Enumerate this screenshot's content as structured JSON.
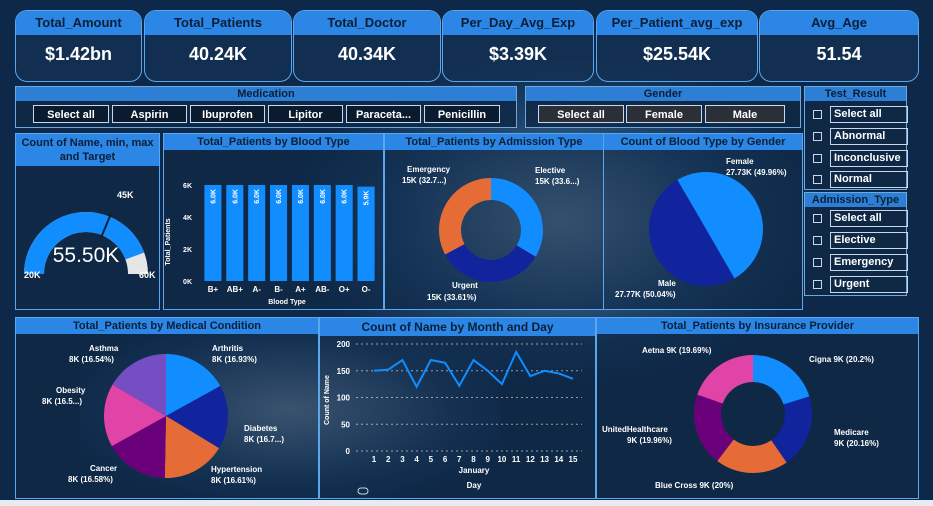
{
  "kpis": [
    {
      "label": "Total_Amount",
      "value": "$1.42bn"
    },
    {
      "label": "Total_Patients",
      "value": "40.24K"
    },
    {
      "label": "Total_Doctor",
      "value": "40.34K"
    },
    {
      "label": "Per_Day_Avg_Exp",
      "value": "$3.39K"
    },
    {
      "label": "Per_Patient_avg_exp",
      "value": "$25.54K"
    },
    {
      "label": "Avg_Age",
      "value": "51.54"
    }
  ],
  "slicers": {
    "medication": {
      "title": "Medication",
      "options": [
        "Select all",
        "Aspirin",
        "Ibuprofen",
        "Lipitor",
        "Paraceta...",
        "Penicillin"
      ]
    },
    "gender": {
      "title": "Gender",
      "options": [
        "Select all",
        "Female",
        "Male"
      ]
    },
    "test_result": {
      "title": "Test_Result",
      "options": [
        "Select all",
        "Abnormal",
        "Inconclusive",
        "Normal"
      ]
    },
    "admission_type": {
      "title": "Admission_Type",
      "options": [
        "Select all",
        "Elective",
        "Emergency",
        "Urgent"
      ]
    }
  },
  "colors": {
    "blue": "#118dff",
    "navy": "#12239e",
    "orange": "#e66c37",
    "purple": "#6b007b",
    "pink": "#e044a7",
    "violet": "#744ec2",
    "gray": "#e6e6e6"
  },
  "chart_data": [
    {
      "type": "gauge",
      "title": "Count of Name, min, max and Target",
      "value_label": "55.50K",
      "value": 55.5,
      "min": 20,
      "max": 60,
      "target": 45,
      "min_label": "20K",
      "max_label": "60K",
      "target_label": "45K"
    },
    {
      "type": "bar",
      "title": "Total_Patients by Blood Type",
      "categories": [
        "B+",
        "AB+",
        "A-",
        "B-",
        "A+",
        "AB-",
        "O+",
        "O-"
      ],
      "values": [
        6.0,
        6.0,
        6.0,
        6.0,
        6.0,
        6.0,
        6.0,
        5.9
      ],
      "data_labels": [
        "6.0K",
        "6.0K",
        "6.0K",
        "6.0K",
        "6.0K",
        "6.0K",
        "6.0K",
        "5.9K"
      ],
      "yticks": [
        "0K",
        "2K",
        "4K",
        "6K"
      ],
      "ylim": [
        0,
        6.5
      ],
      "xlabel": "Blood Type",
      "ylabel": "Total_Patients"
    },
    {
      "type": "donut",
      "title": "Total_Patients by Admission Type",
      "slices": [
        {
          "name": "Elective",
          "value": 33.6,
          "label": "Elective",
          "sublabel": "15K (33.6...)",
          "color": "#118dff"
        },
        {
          "name": "Urgent",
          "value": 33.61,
          "label": "Urgent",
          "sublabel": "15K (33.61%)",
          "color": "#12239e"
        },
        {
          "name": "Emergency",
          "value": 32.79,
          "label": "Emergency",
          "sublabel": "15K (32.7...)",
          "color": "#e66c37"
        }
      ]
    },
    {
      "type": "pie",
      "title": "Count of Blood Type by Gender",
      "slices": [
        {
          "name": "Female",
          "value": 49.96,
          "label": "Female",
          "sublabel": "27.73K (49.96%)",
          "color": "#12239e"
        },
        {
          "name": "Male",
          "value": 50.04,
          "label": "Male",
          "sublabel": "27.77K (50.04%)",
          "color": "#118dff"
        }
      ]
    },
    {
      "type": "pie",
      "title": "Total_Patients by Medical Condition",
      "slices": [
        {
          "name": "Arthritis",
          "value": 16.93,
          "label": "Arthritis",
          "sublabel": "8K (16.93%)",
          "color": "#118dff"
        },
        {
          "name": "Diabetes",
          "value": 16.7,
          "label": "Diabetes",
          "sublabel": "8K (16.7...)",
          "color": "#12239e"
        },
        {
          "name": "Hypertension",
          "value": 16.61,
          "label": "Hypertension",
          "sublabel": "8K (16.61%)",
          "color": "#e66c37"
        },
        {
          "name": "Cancer",
          "value": 16.58,
          "label": "Cancer",
          "sublabel": "8K (16.58%)",
          "color": "#6b007b"
        },
        {
          "name": "Obesity",
          "value": 16.5,
          "label": "Obesity",
          "sublabel": "8K (16.5...)",
          "color": "#e044a7"
        },
        {
          "name": "Asthma",
          "value": 16.54,
          "label": "Asthma",
          "sublabel": "8K (16.54%)",
          "color": "#744ec2"
        }
      ]
    },
    {
      "type": "line",
      "title": "Count of Name by Month and Day",
      "x": [
        1,
        2,
        3,
        4,
        5,
        6,
        7,
        8,
        9,
        10,
        11,
        12,
        13,
        14,
        15
      ],
      "values": [
        150,
        152,
        170,
        120,
        170,
        165,
        122,
        170,
        150,
        125,
        185,
        140,
        150,
        145,
        135
      ],
      "yticks": [
        "0",
        "50",
        "100",
        "150",
        "200"
      ],
      "ylim": [
        0,
        200
      ],
      "xlabel_month": "January",
      "xlabel": "Day",
      "ylabel": "Count of Name",
      "color": "#118dff"
    },
    {
      "type": "donut",
      "title": "Total_Patients by Insurance Provider",
      "slices": [
        {
          "name": "Cigna",
          "value": 20.2,
          "label": "Cigna 9K (20.2%)",
          "color": "#118dff"
        },
        {
          "name": "Medicare",
          "value": 20.16,
          "label": "Medicare",
          "sublabel": "9K (20.16%)",
          "color": "#12239e"
        },
        {
          "name": "Blue Cross",
          "value": 20,
          "label": "Blue Cross 9K (20%)",
          "color": "#e66c37"
        },
        {
          "name": "UnitedHealthcare",
          "value": 19.96,
          "label": "UnitedHealthcare",
          "sublabel": "9K (19.96%)",
          "color": "#6b007b"
        },
        {
          "name": "Aetna",
          "value": 19.69,
          "label": "Aetna 9K (19.69%)",
          "color": "#e044a7"
        }
      ]
    }
  ]
}
